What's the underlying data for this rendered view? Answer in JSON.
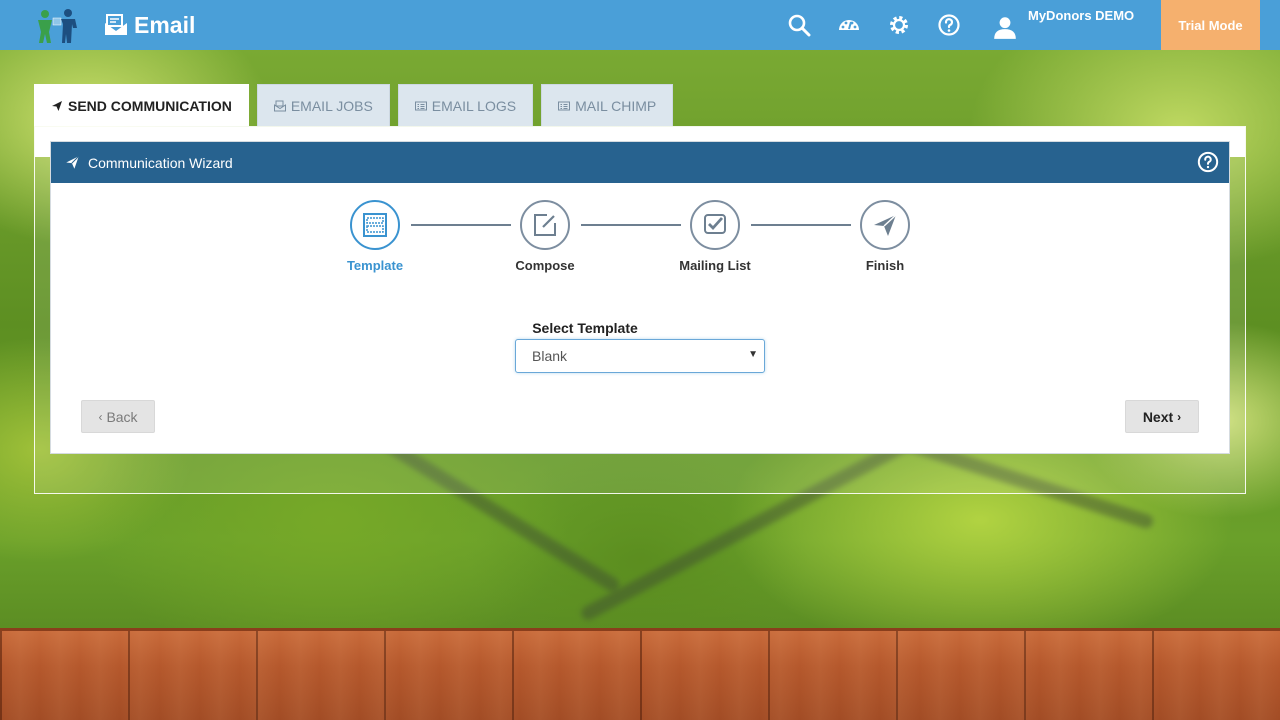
{
  "app": {
    "title": "Email"
  },
  "user": {
    "name": "MyDonors DEMO"
  },
  "trial": {
    "label": "Trial Mode"
  },
  "tabs": [
    {
      "label": "SEND COMMUNICATION",
      "active": true
    },
    {
      "label": "EMAIL JOBS",
      "active": false
    },
    {
      "label": "EMAIL LOGS",
      "active": false
    },
    {
      "label": "MAIL CHIMP",
      "active": false
    }
  ],
  "wizard": {
    "title": "Communication Wizard",
    "steps": [
      {
        "label": "Template",
        "active": true
      },
      {
        "label": "Compose",
        "active": false
      },
      {
        "label": "Mailing List",
        "active": false
      },
      {
        "label": "Finish",
        "active": false
      }
    ],
    "select_label": "Select Template",
    "select_value": "Blank",
    "back_label": "Back",
    "next_label": "Next"
  },
  "colors": {
    "topbar": "#4a9fd8",
    "card_header": "#27628f",
    "active_step": "#3a93d0",
    "trial": "#f5b06e"
  },
  "icons": {
    "top": [
      "search-icon",
      "dashboard-icon",
      "gear-icon",
      "help-icon"
    ],
    "user": "user-icon"
  }
}
